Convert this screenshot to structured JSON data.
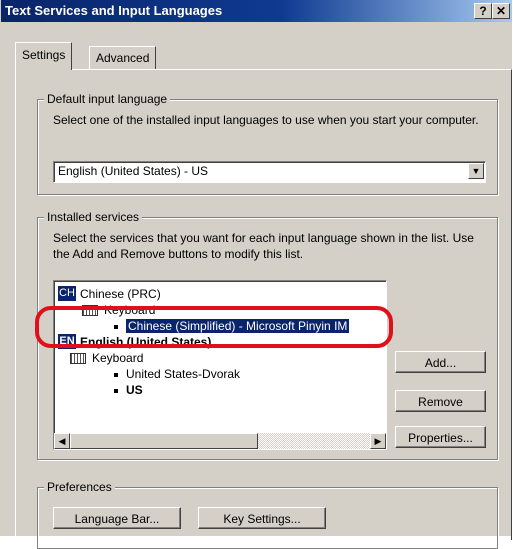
{
  "window": {
    "title": "Text Services and Input Languages",
    "help_button": "?",
    "close_button": "✕"
  },
  "tabs": [
    {
      "label": "Settings",
      "selected": true
    },
    {
      "label": "Advanced",
      "selected": false
    }
  ],
  "default_language": {
    "legend": "Default input language",
    "description": "Select one of the installed input languages to use when you start your computer.",
    "selected_value": "English (United States) - US"
  },
  "installed_services": {
    "legend": "Installed services",
    "description": "Select the services that you want for each input language shown in the list. Use the Add and Remove buttons to modify this list.",
    "tree": [
      {
        "badge": "CH",
        "label": "Chinese (PRC)"
      },
      {
        "label": "Keyboard"
      },
      {
        "label": "Chinese (Simplified) - Microsoft Pinyin IM",
        "selected": true
      },
      {
        "badge": "EN",
        "label": "English (United States)"
      },
      {
        "label": "Keyboard"
      },
      {
        "label": "United States-Dvorak"
      },
      {
        "label": "US"
      }
    ],
    "buttons": {
      "add": "Add...",
      "remove": "Remove",
      "properties": "Properties..."
    }
  },
  "preferences": {
    "legend": "Preferences",
    "language_bar_button": "Language Bar...",
    "key_settings_button": "Key Settings..."
  },
  "colors": {
    "selection": "#0a246a",
    "annotation": "#e0101a",
    "dialog_bg": "#d4d0c8"
  }
}
